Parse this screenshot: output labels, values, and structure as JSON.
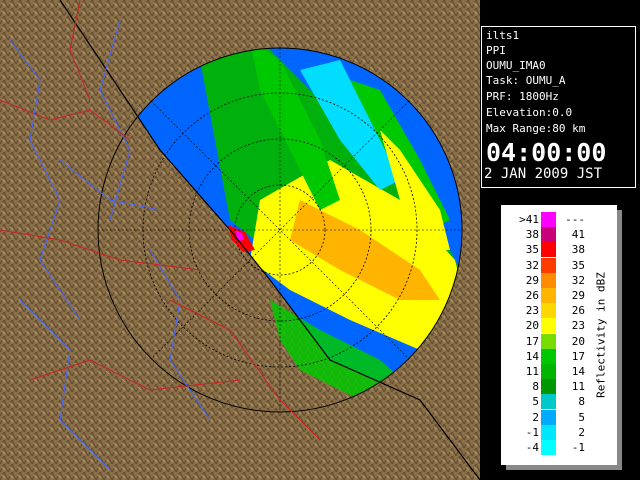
{
  "info": {
    "radar": "ilts1",
    "product": "PPI",
    "site": "OUMU_IMA0",
    "task": "Task: OUMU_A",
    "prf": "PRF: 1800Hz",
    "elevation": "Elevation:0.0",
    "max_range": "Max Range:80 km",
    "time": "04:00:00",
    "date": "2 JAN 2009 JST"
  },
  "legend": {
    "unit": "Reflectivity in dBZ",
    "rows": [
      {
        "low": ">41",
        "high": "---",
        "color": "#ff00ff"
      },
      {
        "low": "38",
        "high": "41",
        "color": "#c8007a"
      },
      {
        "low": "35",
        "high": "38",
        "color": "#ff0000"
      },
      {
        "low": "32",
        "high": "35",
        "color": "#ff3c00"
      },
      {
        "low": "29",
        "high": "32",
        "color": "#ff8c00"
      },
      {
        "low": "26",
        "high": "29",
        "color": "#ffb400"
      },
      {
        "low": "23",
        "high": "26",
        "color": "#ffd700"
      },
      {
        "low": "20",
        "high": "23",
        "color": "#ffff00"
      },
      {
        "low": "17",
        "high": "20",
        "color": "#78dc00"
      },
      {
        "low": "14",
        "high": "17",
        "color": "#00c800"
      },
      {
        "low": "11",
        "high": "14",
        "color": "#00b400"
      },
      {
        "low": "8",
        "high": "11",
        "color": "#009600"
      },
      {
        "low": "5",
        "high": "8",
        "color": "#00c8c8"
      },
      {
        "low": "2",
        "high": "5",
        "color": "#00aaff"
      },
      {
        "low": "-1",
        "high": "2",
        "color": "#00e6ff"
      },
      {
        "low": "-4",
        "high": "-1",
        "color": "#00ffff"
      }
    ]
  },
  "colors": {
    "sea": "#0055ee",
    "range_ring_fill": "#0022cc",
    "land": "#8b6f47",
    "rivers": "#4466ff",
    "roads": "#cc2222"
  }
}
